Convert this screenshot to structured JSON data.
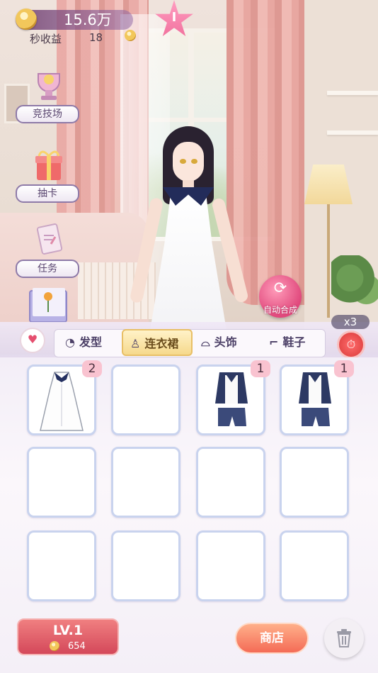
{
  "hud": {
    "coin_value": "15.6万",
    "rate_label": "秒收益",
    "rate_value": "18",
    "star_label": "I"
  },
  "side_menu": [
    {
      "label": "竞技场",
      "icon": "trophy-icon"
    },
    {
      "label": "抽卡",
      "icon": "gift-box-icon"
    },
    {
      "label": "任务",
      "icon": "letter-card-icon"
    }
  ],
  "auto_merge": {
    "label": "自动合成",
    "icon": "refresh-icon"
  },
  "speed_multiplier": "x3",
  "tabs": [
    {
      "label": "发型",
      "icon": "hair-icon",
      "active": false
    },
    {
      "label": "连衣裙",
      "icon": "dress-icon",
      "active": true
    },
    {
      "label": "头饰",
      "icon": "hat-icon",
      "active": false
    },
    {
      "label": "鞋子",
      "icon": "shoe-icon",
      "active": false
    }
  ],
  "grid": {
    "rows": 3,
    "cols": 4,
    "items": [
      {
        "slot": 0,
        "item": "white-dress",
        "count": "2"
      },
      {
        "slot": 2,
        "item": "sailor-outfit",
        "count": "1"
      },
      {
        "slot": 3,
        "item": "sailor-outfit",
        "count": "1"
      }
    ]
  },
  "level": {
    "label": "LV.1",
    "cost": "654"
  },
  "shop": {
    "label": "商店"
  },
  "colors": {
    "accent_pink": "#e0487c",
    "badge": "#f9c3d0",
    "cell_border": "#c9d3ee"
  }
}
